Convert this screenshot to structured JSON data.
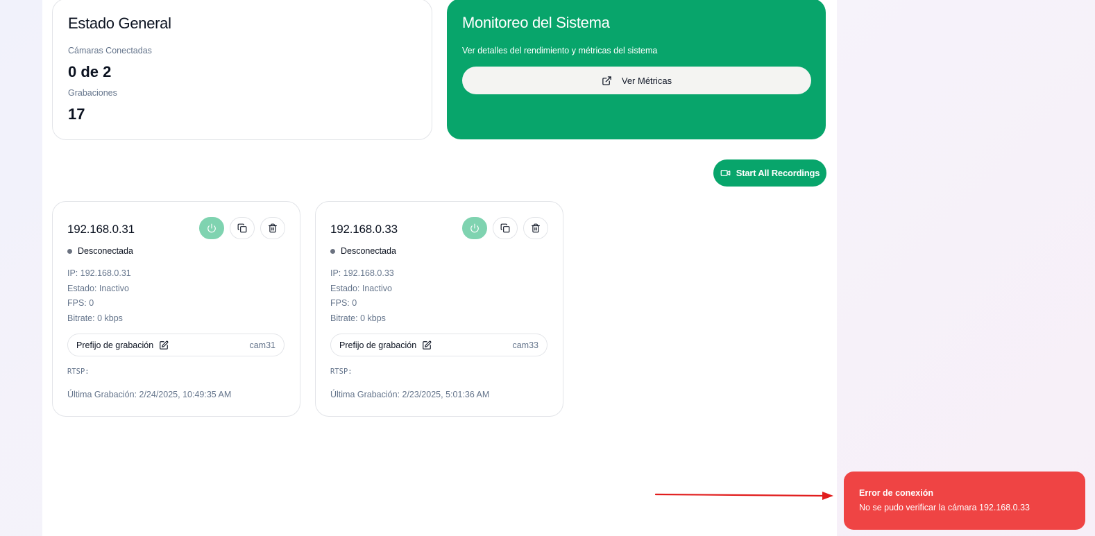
{
  "status_card": {
    "title": "Estado General",
    "cameras_label": "Cámaras Conectadas",
    "cameras_value": "0 de 2",
    "recordings_label": "Grabaciones",
    "recordings_value": "17"
  },
  "monitor_card": {
    "title": "Monitoreo del Sistema",
    "description": "Ver detalles del rendimiento y métricas del sistema",
    "button_label": "Ver Métricas",
    "button_icon": "external-link-icon"
  },
  "start_all": {
    "label": "Start All Recordings",
    "icon": "video-icon"
  },
  "cameras": [
    {
      "name": "192.168.0.31",
      "status": "Desconectada",
      "ip": "IP: 192.168.0.31",
      "state": "Estado: Inactivo",
      "fps": "FPS: 0",
      "bitrate": "Bitrate: 0 kbps",
      "prefix_label": "Prefijo de grabación",
      "prefix_value": "cam31",
      "rtsp": "RTSP:",
      "last_recording": "Última Grabación: 2/24/2025, 10:49:35 AM"
    },
    {
      "name": "192.168.0.33",
      "status": "Desconectada",
      "ip": "IP: 192.168.0.33",
      "state": "Estado: Inactivo",
      "fps": "FPS: 0",
      "bitrate": "Bitrate: 0 kbps",
      "prefix_label": "Prefijo de grabación",
      "prefix_value": "cam33",
      "rtsp": "RTSP:",
      "last_recording": "Última Grabación: 2/23/2025, 5:01:36 AM"
    }
  ],
  "toast": {
    "title": "Error de conexión",
    "message": "No se pudo verificar la cámara 192.168.0.33"
  },
  "colors": {
    "brand_green": "#08a56b",
    "power_button": "#7fd3b0",
    "error_red": "#ef4444",
    "annotation_arrow": "#e11d1d"
  }
}
